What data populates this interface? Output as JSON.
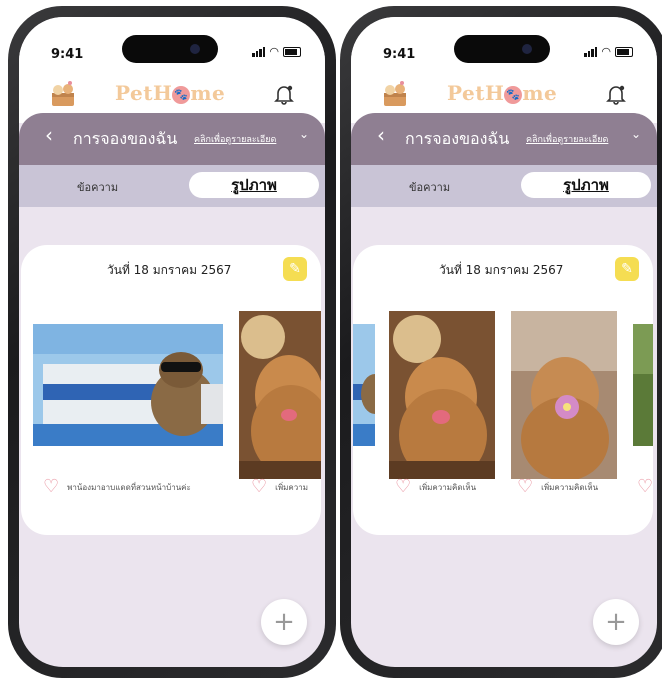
{
  "status": {
    "time": "9:41"
  },
  "app": {
    "brand": "PetHome",
    "brand_prefix": "PetH",
    "brand_suffix": "me"
  },
  "header": {
    "back": "‹",
    "title": "การจองของฉัน",
    "detail_link": "คลิกเพื่อดูรายละเอียด",
    "chevron": "⌄"
  },
  "tabs": {
    "messages": "ข้อความ",
    "photos": "รูปภาพ"
  },
  "card": {
    "date": "วันที่ 18 มกราคม 2567"
  },
  "screen1": {
    "photos": [
      {
        "subject": "dog with sunglasses on bed",
        "caption": "พาน้องมาอาบแดดที่สวนหน้าบ้านค่ะ"
      },
      {
        "subject": "golden retriever autumn",
        "caption": "เพิ่มความ"
      }
    ]
  },
  "screen2": {
    "photos": [
      {
        "subject": "golden retriever autumn",
        "caption": "เพิ่มความคิดเห็น"
      },
      {
        "subject": "golden retriever with flower",
        "caption": "เพิ่มความคิดเห็น"
      }
    ]
  },
  "fab": {
    "label": "+"
  },
  "colors": {
    "header": "#8f7f92",
    "tabs": "#c9c4d6",
    "background": "#ebe4ee",
    "brand": "#f3c99a",
    "heart": "#e88f9c",
    "edit": "#f5dd52"
  }
}
